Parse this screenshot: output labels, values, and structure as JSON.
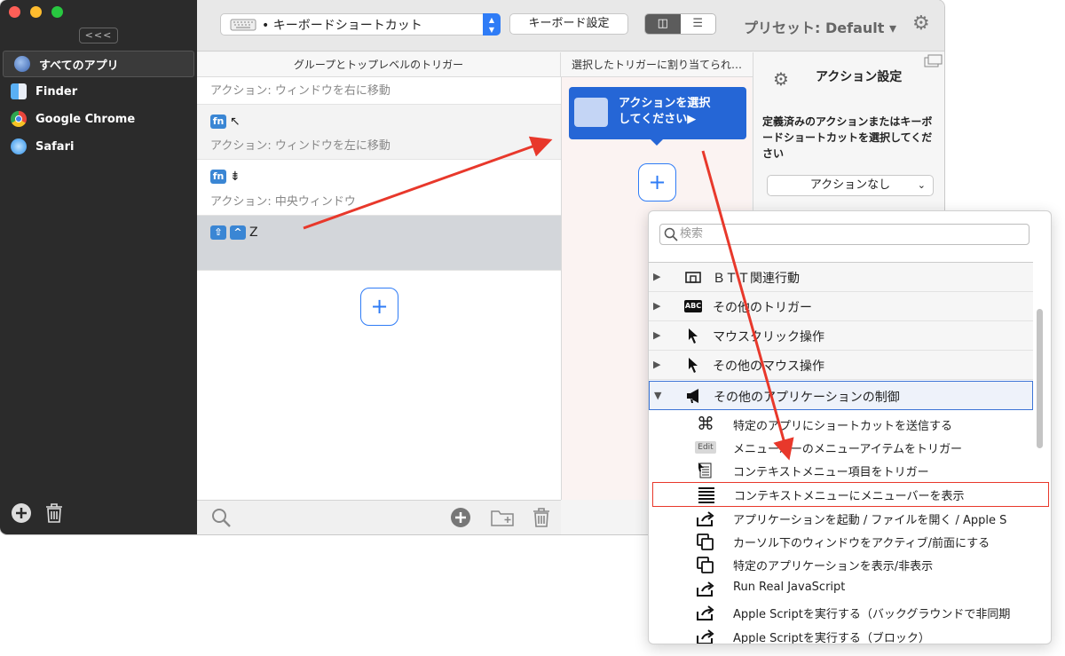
{
  "sidebar": {
    "collapse_label": "<<<",
    "apps": [
      {
        "label": "すべてのアプリ",
        "color": "#4a78c8"
      },
      {
        "label": "Finder",
        "color": "#3e8ee8"
      },
      {
        "label": "Google Chrome",
        "color": "#e8453c"
      },
      {
        "label": "Safari",
        "color": "#3aa0f0"
      }
    ]
  },
  "toolbar": {
    "trigger_type": "• キーボードショートカット",
    "keyboard_settings": "キーボード設定",
    "preset": "プリセット: Default ▾"
  },
  "columns": {
    "triggers_header": "グループとトップレベルのトリガー",
    "actions_header": "選択したトリガーに割り当てられ…"
  },
  "triggers": [
    {
      "keys": [],
      "symbol": "",
      "action": "アクション: ウィンドウを右に移動"
    },
    {
      "keys": [
        "fn"
      ],
      "symbol": "↖",
      "action": "アクション: ウィンドウを左に移動"
    },
    {
      "keys": [
        "fn"
      ],
      "symbol": "⇟",
      "action": "アクション: 中央ウィンドウ"
    },
    {
      "keys": [
        "⇧",
        "^"
      ],
      "symbol": "Z",
      "action": ""
    }
  ],
  "action_card": {
    "line1": "アクションを選択",
    "line2": "してください▶"
  },
  "action_settings": {
    "title": "アクション設定",
    "description": "定義済みのアクションまたはキーボードショートカットを選択してください",
    "dropdown": "アクションなし"
  },
  "popup": {
    "search_placeholder": "検索",
    "categories": [
      {
        "label": "ＢＴＴ関連行動",
        "icon": "btt-icon"
      },
      {
        "label": "その他のトリガー",
        "icon": "abc-icon"
      },
      {
        "label": "マウスクリック操作",
        "icon": "cursor-icon"
      },
      {
        "label": "その他のマウス操作",
        "icon": "cursor-icon"
      },
      {
        "label": "その他のアプリケーションの制御",
        "icon": "megaphone-icon"
      }
    ],
    "subitems": [
      {
        "label": "特定のアプリにショートカットを送信する",
        "icon": "⌘"
      },
      {
        "label": "メニューバーのメニューアイテムをトリガー",
        "icon": "Edit"
      },
      {
        "label": "コンテキストメニュー項目をトリガー",
        "icon": "▤"
      },
      {
        "label": "コンテキストメニューにメニューバーを表示",
        "icon": "≣"
      },
      {
        "label": "アプリケーションを起動 / ファイルを開く / Apple S",
        "icon": "⇗"
      },
      {
        "label": "カーソル下のウィンドウをアクティブ/前面にする",
        "icon": "❐"
      },
      {
        "label": "特定のアプリケーションを表示/非表示",
        "icon": "❐"
      },
      {
        "label": "Run Real JavaScript",
        "icon": "⇗"
      },
      {
        "label": "Apple Scriptを実行する（バックグラウンドで非同期",
        "icon": "⇗"
      },
      {
        "label": "Apple Scriptを実行する（ブロック）",
        "icon": "⇗"
      }
    ]
  },
  "colors": {
    "accent": "#2f7cf6",
    "annotation": "#e8382b"
  }
}
